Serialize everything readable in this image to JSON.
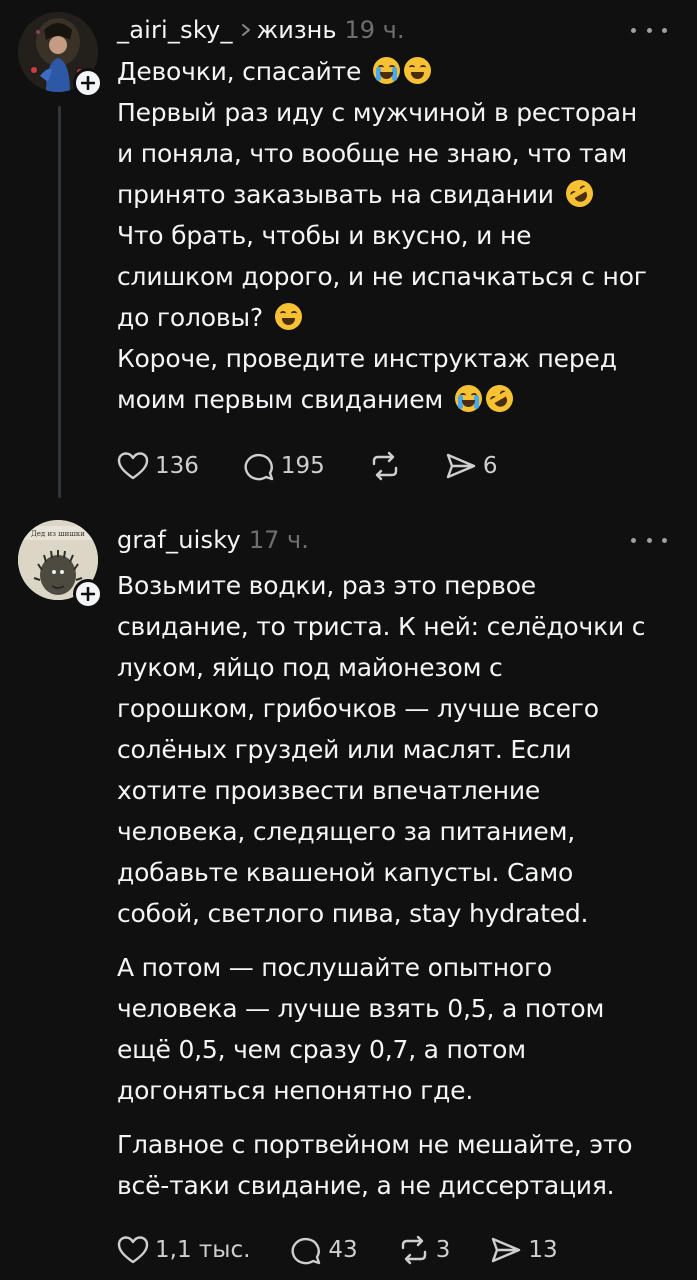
{
  "posts": [
    {
      "username": "_airi_sky_",
      "community": "жизнь",
      "time": "19 ч.",
      "avatar_icon": "user-photo",
      "paragraphs": [
        {
          "lines": [
            {
              "text": "Девочки, спасайте",
              "emoji": [
                "cry",
                "laugh"
              ]
            },
            {
              "text": "Первый раз иду с мужчиной в ресторан"
            },
            {
              "text": "и поняла, что вообще не знаю, что там"
            },
            {
              "text": "принято заказывать на свидании",
              "emoji": [
                "rofl"
              ]
            },
            {
              "text": "Что брать, чтобы и вкусно, и не"
            },
            {
              "text": "слишком дорого, и не испачкаться с ног"
            },
            {
              "text": "до головы?",
              "emoji": [
                "laugh"
              ]
            },
            {
              "text": "Короче, проведите инструктаж перед"
            },
            {
              "text": "моим первым свиданием",
              "emoji": [
                "cry",
                "rofl"
              ]
            }
          ]
        }
      ],
      "likes": "136",
      "replies": "195",
      "reposts": "",
      "shares": "6"
    },
    {
      "username": "graf_uisky",
      "community": "",
      "time": "17 ч.",
      "avatar_icon": "hedgehog-drawing",
      "avatar_caption": "Дед из шишки",
      "paragraphs": [
        {
          "lines": [
            {
              "text": "Возьмите водки, раз это первое"
            },
            {
              "text": "свидание, то триста. К ней:  селёдочки с"
            },
            {
              "text": "луком, яйцо под майонезом с"
            },
            {
              "text": "горошком, грибочков — лучше всего"
            },
            {
              "text": "солёных груздей или маслят. Если"
            },
            {
              "text": "хотите произвести впечатление"
            },
            {
              "text": "человека, следящего за питанием,"
            },
            {
              "text": "добавьте квашеной капусты. Само"
            },
            {
              "text": "собой, светлого пива, stay hydrated."
            }
          ]
        },
        {
          "lines": [
            {
              "text": "А потом — послушайте опытного"
            },
            {
              "text": "человека — лучше взять 0,5, а потом"
            },
            {
              "text": "ещё 0,5, чем сразу 0,7, а потом"
            },
            {
              "text": "догоняться непонятно где."
            }
          ]
        },
        {
          "lines": [
            {
              "text": "Главное с портвейном не мешайте, это"
            },
            {
              "text": "всё-таки свидание, а не диссертация."
            }
          ]
        }
      ],
      "likes": "1,1 тыс.",
      "replies": "43",
      "reposts": "3",
      "shares": "13"
    }
  ],
  "icons": {
    "like": "heart-icon",
    "reply": "comment-icon",
    "repost": "repost-icon",
    "share": "send-icon",
    "more": "more-dots-icon",
    "follow": "plus-icon"
  },
  "colors": {
    "background": "#101010",
    "text": "#f3f5f7",
    "muted": "#6f6f6f",
    "thread_line": "#333638"
  }
}
